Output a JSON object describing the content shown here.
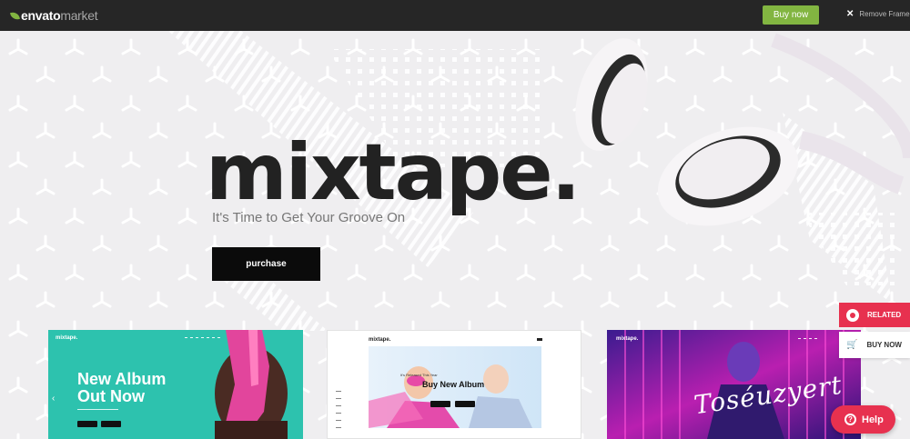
{
  "topbar": {
    "logo_envato": "envato",
    "logo_market": "market",
    "buy_now": "Buy now",
    "remove_frame": "Remove Frame"
  },
  "hero": {
    "title": "mixtape.",
    "subtitle": "It's Time to Get Your Groove On",
    "purchase": "purchase"
  },
  "thumbnails": [
    {
      "brand": "mixtape.",
      "heading_line1": "New Album",
      "heading_line2": "Out Now",
      "accent": "#2dc2ae"
    },
    {
      "brand": "mixtape.",
      "small_line": "It's Released This Year",
      "heading": "Buy New Album",
      "accent": "#ffffff"
    },
    {
      "brand": "mixtape.",
      "script": "Toséuzyert",
      "accent": "#241d6b"
    }
  ],
  "side": {
    "related": "RELATED",
    "buy_now": "BUY NOW",
    "help": "Help"
  },
  "colors": {
    "envato_green": "#82b541",
    "accent_red": "#e7314f",
    "dark": "#262626"
  },
  "icons": [
    "envato-leaf-icon",
    "close-icon",
    "related-icon",
    "cart-icon",
    "help-icon",
    "arrow-left-icon",
    "arrow-right-icon"
  ]
}
